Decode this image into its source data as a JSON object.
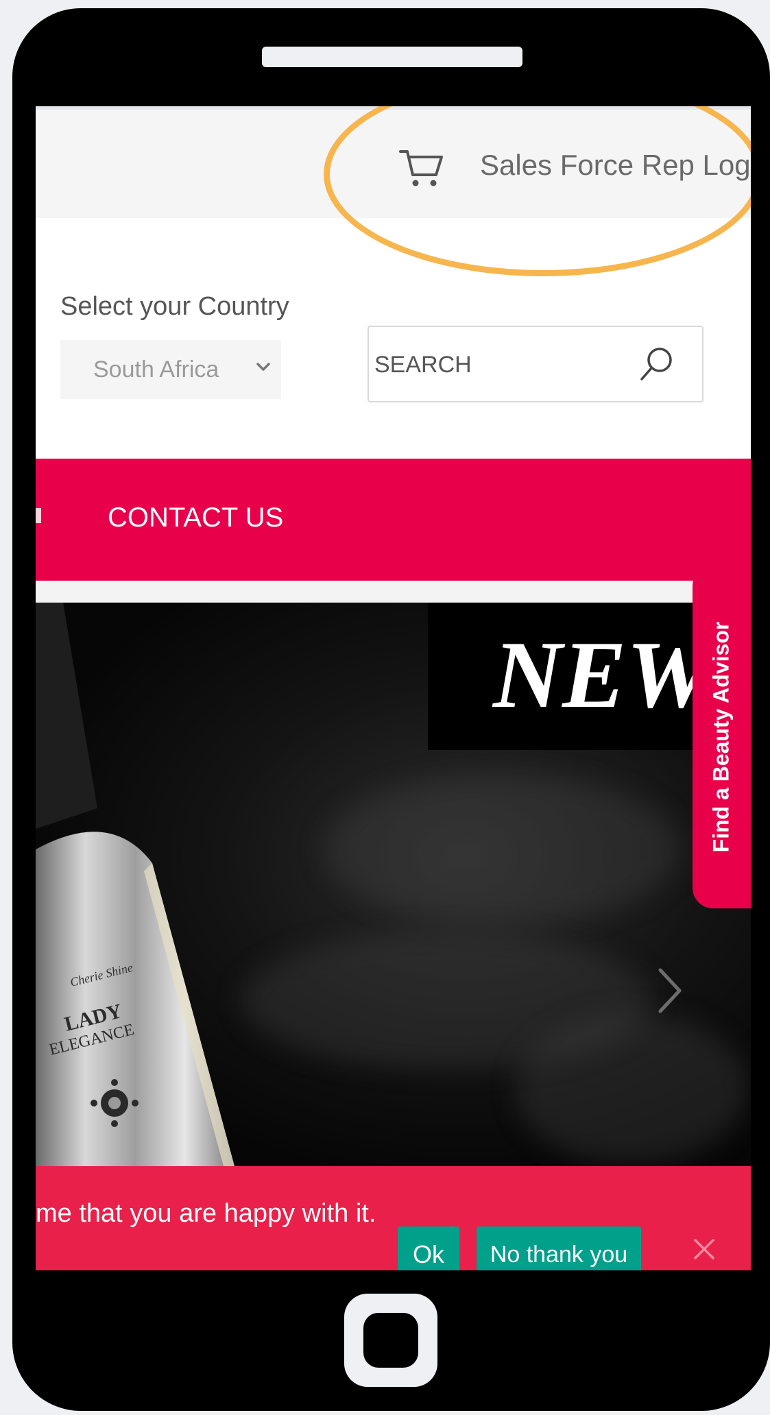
{
  "header": {
    "rep_login": "Sales Force Rep Login"
  },
  "country": {
    "label": "Select your Country",
    "selected": "South Africa"
  },
  "search": {
    "placeholder": "SEARCH"
  },
  "nav": {
    "contact": "CONTACT US"
  },
  "hero": {
    "headline": "NEW",
    "bottle_brand": "Cherie Shine",
    "bottle_name_1": "LADY",
    "bottle_name_2": "ELEGANCE"
  },
  "beauty_tab": {
    "label": "Find a Beauty Advisor"
  },
  "cookie": {
    "text": "me that you are happy with it.",
    "ok": "Ok",
    "no": "No thank you"
  },
  "colors": {
    "brand": "#e8004a",
    "accent_button": "#00a08a",
    "highlight": "#f7b54e"
  },
  "icons": [
    "cart-icon",
    "search-icon",
    "chevron-down-icon",
    "chevron-right-icon",
    "close-icon"
  ]
}
